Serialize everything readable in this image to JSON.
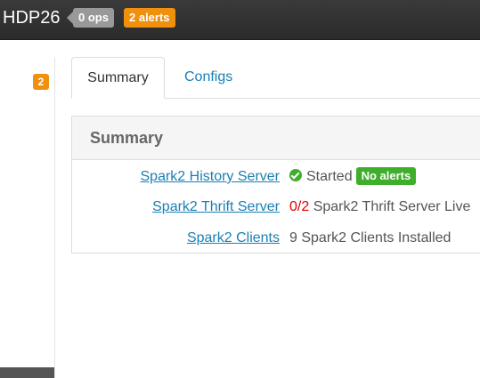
{
  "header": {
    "cluster_name": "HDP26",
    "ops_badge": "0 ops",
    "alerts_badge": "2 alerts"
  },
  "sidebar": {
    "alert_count": "2"
  },
  "tabs": [
    {
      "label": "Summary",
      "active": true
    },
    {
      "label": "Configs",
      "active": false
    }
  ],
  "summary": {
    "title": "Summary",
    "rows": [
      {
        "link": "Spark2 History Server",
        "status_icon": "check-circle-icon",
        "status": "Started",
        "badge": "No alerts"
      },
      {
        "link": "Spark2 Thrift Server",
        "live_count": "0/2",
        "text": "Spark2 Thrift Server Live"
      },
      {
        "link": "Spark2 Clients",
        "text": "9 Spark2 Clients Installed"
      }
    ]
  },
  "colors": {
    "topbar": "#2f2f2f",
    "alert_orange": "#f0900c",
    "ok_green": "#3fae2a",
    "link_blue": "#1a7fb4",
    "error_red": "#e00000"
  }
}
